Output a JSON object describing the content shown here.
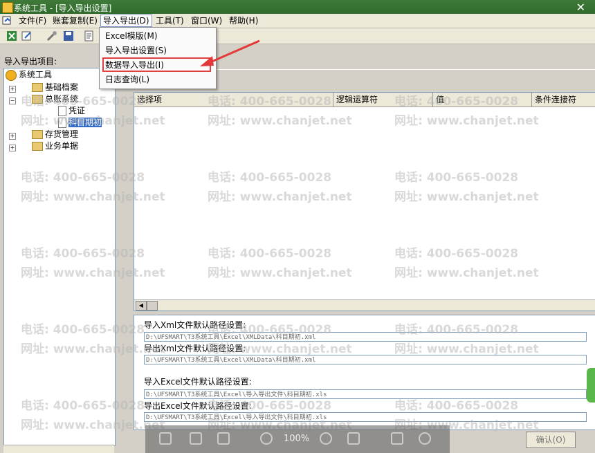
{
  "window": {
    "title": "系统工具 - [导入导出设置]"
  },
  "menu": {
    "items": [
      {
        "label": "文件(F)"
      },
      {
        "label": "账套复制(E)"
      },
      {
        "label": "导入导出(D)"
      },
      {
        "label": "工具(T)"
      },
      {
        "label": "窗口(W)"
      },
      {
        "label": "帮助(H)"
      }
    ]
  },
  "dropdown": {
    "items": [
      {
        "label": "Excel模版(M)"
      },
      {
        "label": "导入导出设置(S)"
      },
      {
        "label": "数据导入导出(I)"
      },
      {
        "label": "日志查询(L)"
      }
    ]
  },
  "left_panel": {
    "label": "导入导出项目:",
    "tree": {
      "root": "系统工具",
      "items": [
        "基础档案",
        "总账系统",
        "凭证",
        "科目期初",
        "存货管理",
        "业务单据"
      ]
    }
  },
  "grid": {
    "columns": [
      "选择项",
      "逻辑运算符",
      "值",
      "条件连接符"
    ]
  },
  "paths": {
    "import_xml_label": "导入Xml文件默认路径设置:",
    "import_xml_value": "D:\\UFSMART\\T3系统工具\\Excel\\XMLData\\科目期初.xml",
    "export_xml_label": "导出Xml文件默认路径设置:",
    "export_xml_value": "D:\\UFSMART\\T3系统工具\\Excel\\XMLData\\科目期初.xml",
    "import_excel_label": "导入Excel文件默认路径设置:",
    "import_excel_value": "D:\\UFSMART\\T3系统工具\\Excel\\导入导出文件\\科目期初.xls",
    "export_excel_label": "导出Excel文件默认路径设置:",
    "export_excel_value": "D:\\UFSMART\\T3系统工具\\Excel\\导入导出文件\\科目期初.xls"
  },
  "buttons": {
    "ok": "确认(O)"
  },
  "viewer": {
    "zoom": "100%"
  },
  "watermark": {
    "phone": "电话: 400-665-0028",
    "site": "网址: www.chanjet.net"
  },
  "colors": {
    "title_bar": "#2f6b2c",
    "selection": "#316ac5",
    "highlight_box": "#e04040"
  }
}
